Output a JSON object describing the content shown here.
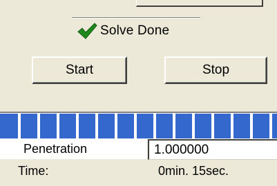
{
  "status": {
    "icon": "checkmark-icon",
    "text": "Solve Done",
    "icon_color": "#1e8a1e"
  },
  "buttons": {
    "start_label": "Start",
    "stop_label": "Stop"
  },
  "progress": {
    "fraction": 1.0,
    "fill_color": "#3468cd"
  },
  "penetration": {
    "label": "Penetration",
    "value": "1.000000"
  },
  "time": {
    "label": "Time:",
    "value": "0min. 15sec."
  }
}
